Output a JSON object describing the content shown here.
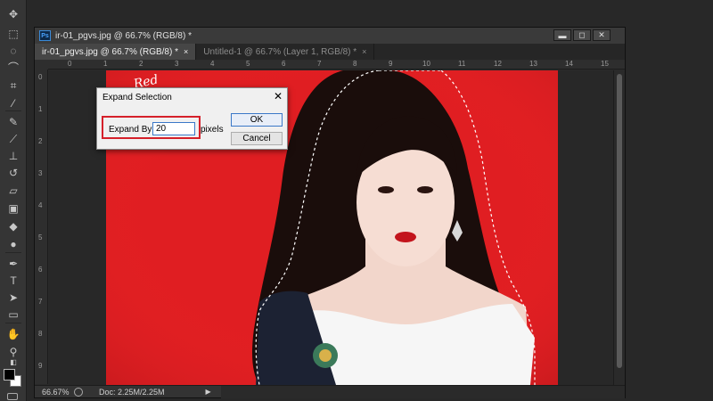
{
  "document": {
    "title": "ir-01_pgvs.jpg @ 66.7% (RGB/8) *",
    "badge": "Ps",
    "tabs": [
      {
        "label": "ir-01_pgvs.jpg @ 66.7% (RGB/8) *",
        "close": "×"
      },
      {
        "label": "Untitled-1 @ 66.7% (Layer 1, RGB/8) *",
        "close": "×"
      }
    ],
    "window_controls": {
      "minimize": "▬",
      "maximize": "◻",
      "close": "✕"
    }
  },
  "rulers": {
    "horizontal": [
      "0",
      "1",
      "2",
      "3",
      "4",
      "5",
      "6",
      "7",
      "8",
      "9",
      "10",
      "11",
      "12",
      "13",
      "14",
      "15"
    ],
    "vertical": [
      "0",
      "1",
      "2",
      "3",
      "4",
      "5",
      "6",
      "7",
      "8",
      "9"
    ]
  },
  "status": {
    "zoom": "66.67%",
    "doc_size": "Doc: 2.25M/2.25M",
    "arrow": "▶"
  },
  "dialog": {
    "title": "Expand Selection",
    "close": "✕",
    "field_label": "Expand By:",
    "field_value": "20",
    "unit": "pixels",
    "ok_label": "OK",
    "cancel_label": "Cancel"
  },
  "image": {
    "background_color": "#e01e22",
    "text_top": "Red",
    "selection": "marching ants around subject"
  },
  "tools": [
    "move-icon",
    "marquee-icon",
    "lasso-icon",
    "quick-select-icon",
    "crop-icon",
    "eyedropper-icon",
    "healing-brush-icon",
    "brush-icon",
    "stamp-icon",
    "history-brush-icon",
    "eraser-icon",
    "gradient-icon",
    "blur-icon",
    "dodge-icon",
    "pen-icon",
    "type-icon",
    "path-select-icon",
    "shape-icon",
    "hand-icon",
    "zoom-icon"
  ],
  "colors": {
    "foreground": "#000000",
    "background": "#ffffff",
    "accent_highlight": "#d5202a"
  }
}
